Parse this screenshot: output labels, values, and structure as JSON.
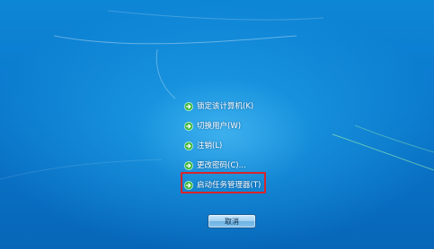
{
  "menu": {
    "items": [
      {
        "label": "锁定该计算机(K)",
        "icon": "green-arrow-icon"
      },
      {
        "label": "切换用户(W)",
        "icon": "green-arrow-icon"
      },
      {
        "label": "注销(L)",
        "icon": "green-arrow-icon"
      },
      {
        "label": "更改密码(C)...",
        "icon": "green-arrow-icon"
      },
      {
        "label": "启动任务管理器(T)",
        "icon": "green-arrow-icon"
      }
    ],
    "highlighted_item": "启动任务管理器(T)"
  },
  "cancel_button": {
    "label": "取消"
  },
  "colors": {
    "background": "#0a78cc",
    "highlight_border": "#d8242a",
    "arrow_green": "#3db83a"
  }
}
